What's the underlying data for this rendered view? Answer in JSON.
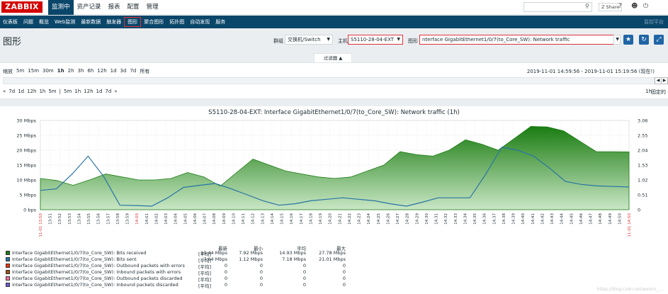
{
  "header": {
    "logo": "ZABBIX",
    "menu": [
      {
        "label": "监测中",
        "active": true
      },
      {
        "label": "资产记录",
        "active": false
      },
      {
        "label": "报表",
        "active": false
      },
      {
        "label": "配置",
        "active": false
      },
      {
        "label": "管理",
        "active": false
      }
    ],
    "share_label": "Share",
    "help_icon": "?",
    "user_icon": "user-icon",
    "power_icon": "power-icon"
  },
  "submenu": {
    "items": [
      {
        "label": "仪表板",
        "active": false
      },
      {
        "label": "问题",
        "active": false
      },
      {
        "label": "概览",
        "active": false
      },
      {
        "label": "Web监测",
        "active": false
      },
      {
        "label": "最新数据",
        "active": false
      },
      {
        "label": "触发器",
        "active": false
      },
      {
        "label": "图形",
        "active": true
      },
      {
        "label": "聚合图形",
        "active": false
      },
      {
        "label": "拓扑图",
        "active": false
      },
      {
        "label": "自动发现",
        "active": false
      },
      {
        "label": "服务",
        "active": false
      }
    ],
    "right_label": "监控平台"
  },
  "page": {
    "title": "图形",
    "group_label": "群组",
    "group_value": "交换机/Switch",
    "host_label": "主机",
    "host_value": "S5110-28-04-EXT",
    "graph_label": "图形",
    "graph_value": "nterface GigabitEthernet1/0/7(to_Core_SW): Network traffic"
  },
  "filter": {
    "tab_label": "过滤器 ▲",
    "zoom_label": "缩放",
    "zoom_options": [
      "5m",
      "15m",
      "30m",
      "1h",
      "2h",
      "3h",
      "6h",
      "12h",
      "1d",
      "3d",
      "7d",
      "所有"
    ],
    "zoom_selected": "1h",
    "date_range": "2019-11-01 14:59:56 - 2019-11-01 15:19:56 (现在!)",
    "nav_left": [
      "«",
      "7d",
      "1d",
      "12h",
      "1h",
      "5m",
      "|",
      "5m",
      "1h",
      "12h",
      "1d",
      "7d",
      "»"
    ],
    "period": "1h",
    "fixed_label": "固定的"
  },
  "graph": {
    "title": "S5110-28-04-EXT: Interface GigabitEthernet1/0/7(to_Core_SW): Network traffic (1h)",
    "legend_headers": [
      "最新",
      "最小",
      "平均",
      "最大"
    ],
    "legend": [
      {
        "name": "Interface GigabitEthernet1/0/7(to_Core_SW): Bits received",
        "fn": "[平均]",
        "last": "19.44 Mbps",
        "min": "7.92 Mbps",
        "avg": "14.93 Mbps",
        "max": "27.78 Mbps",
        "color": "#1a7c11"
      },
      {
        "name": "Interface GigabitEthernet1/0/7(to_Core_SW): Bits sent",
        "fn": "[平均]",
        "last": "7.64 Mbps",
        "min": "1.12 Mbps",
        "avg": "7.18 Mbps",
        "max": "21.01 Mbps",
        "color": "#2774a4"
      },
      {
        "name": "Interface GigabitEthernet1/0/7(to_Core_SW): Outbound packets with errors",
        "fn": "[平均]",
        "last": "0",
        "min": "0",
        "avg": "0",
        "max": "0",
        "color": "#f63100"
      },
      {
        "name": "Interface GigabitEthernet1/0/7(to_Core_SW): Inbound packets with errors",
        "fn": "[平均]",
        "last": "0",
        "min": "0",
        "avg": "0",
        "max": "0",
        "color": "#a54f10"
      },
      {
        "name": "Interface GigabitEthernet1/0/7(to_Core_SW): Outbound packets discarded",
        "fn": "[平均]",
        "last": "0",
        "min": "0",
        "avg": "0",
        "max": "0",
        "color": "#fc6ea3"
      },
      {
        "name": "Interface GigabitEthernet1/0/7(to_Core_SW): Inbound packets discarded",
        "fn": "[平均]",
        "last": "0",
        "min": "0",
        "avg": "0",
        "max": "0",
        "color": "#6c59dc"
      }
    ],
    "watermark": "https://blog.csdn.net/weixin_..."
  },
  "chart_data": {
    "type": "area",
    "title": "S5110-28-04-EXT: Interface GigabitEthernet1/0/7(to_Core_SW): Network traffic (1h)",
    "x": [
      "13:50",
      "13:52",
      "13:54",
      "13:56",
      "13:58",
      "14:00",
      "14:02",
      "14:04",
      "14:06",
      "14:08",
      "14:10",
      "14:12",
      "14:14",
      "14:16",
      "14:18",
      "14:20",
      "14:22",
      "14:24",
      "14:26",
      "14:28",
      "14:30",
      "14:32",
      "14:34",
      "14:36",
      "14:38",
      "14:40",
      "14:42",
      "14:44",
      "14:46",
      "14:48",
      "14:50"
    ],
    "xticks": [
      "11-01 13:50",
      "13:51",
      "13:52",
      "13:53",
      "13:54",
      "13:55",
      "13:56",
      "13:57",
      "13:58",
      "13:59",
      "14:00",
      "14:01",
      "14:02",
      "14:03",
      "14:04",
      "14:05",
      "14:06",
      "14:07",
      "14:08",
      "14:09",
      "14:10",
      "14:11",
      "14:12",
      "14:13",
      "14:14",
      "14:15",
      "14:16",
      "14:17",
      "14:18",
      "14:19",
      "14:20",
      "14:21",
      "14:22",
      "14:23",
      "14:24",
      "14:25",
      "14:26",
      "14:27",
      "14:28",
      "14:29",
      "14:30",
      "14:31",
      "14:32",
      "14:33",
      "14:34",
      "14:35",
      "14:36",
      "14:37",
      "14:38",
      "14:39",
      "14:40",
      "14:41",
      "14:42",
      "14:43",
      "14:44",
      "14:45",
      "14:46",
      "14:47",
      "14:48",
      "14:49",
      "14:50",
      "11-01 14:50"
    ],
    "yticks_left": [
      "0 bps",
      "5 Mbps",
      "10 Mbps",
      "15 Mbps",
      "20 Mbps",
      "25 Mbps",
      "30 Mbps"
    ],
    "yticks_right": [
      "0",
      "0.51",
      "1.02",
      "1.53",
      "2.04",
      "2.55",
      "3.06"
    ],
    "ylim": [
      0,
      30
    ],
    "series": [
      {
        "name": "Bits received",
        "color": "#1a7c11",
        "values": [
          10.5,
          9.8,
          8.2,
          10,
          12,
          11,
          10,
          10,
          10.5,
          12.5,
          11,
          7.9,
          12.5,
          17,
          15,
          13,
          12,
          11,
          10.5,
          11,
          13,
          15,
          19.5,
          18.5,
          18,
          20,
          23.5,
          22,
          20,
          24,
          28,
          27.8,
          26.5,
          23,
          19.5,
          19.5,
          19.44
        ]
      },
      {
        "name": "Bits sent",
        "color": "#2774a4",
        "values": [
          6.5,
          7,
          12,
          18,
          11,
          1.5,
          1.4,
          1.2,
          4,
          7.5,
          8.2,
          8.8,
          7,
          5,
          3,
          1.5,
          2,
          3,
          3.5,
          4,
          3.5,
          3,
          2,
          1.2,
          2.5,
          4,
          4,
          4,
          12,
          21,
          20,
          18,
          14,
          9.5,
          8.5,
          8,
          7.8,
          7.64
        ]
      }
    ],
    "grid": true
  }
}
